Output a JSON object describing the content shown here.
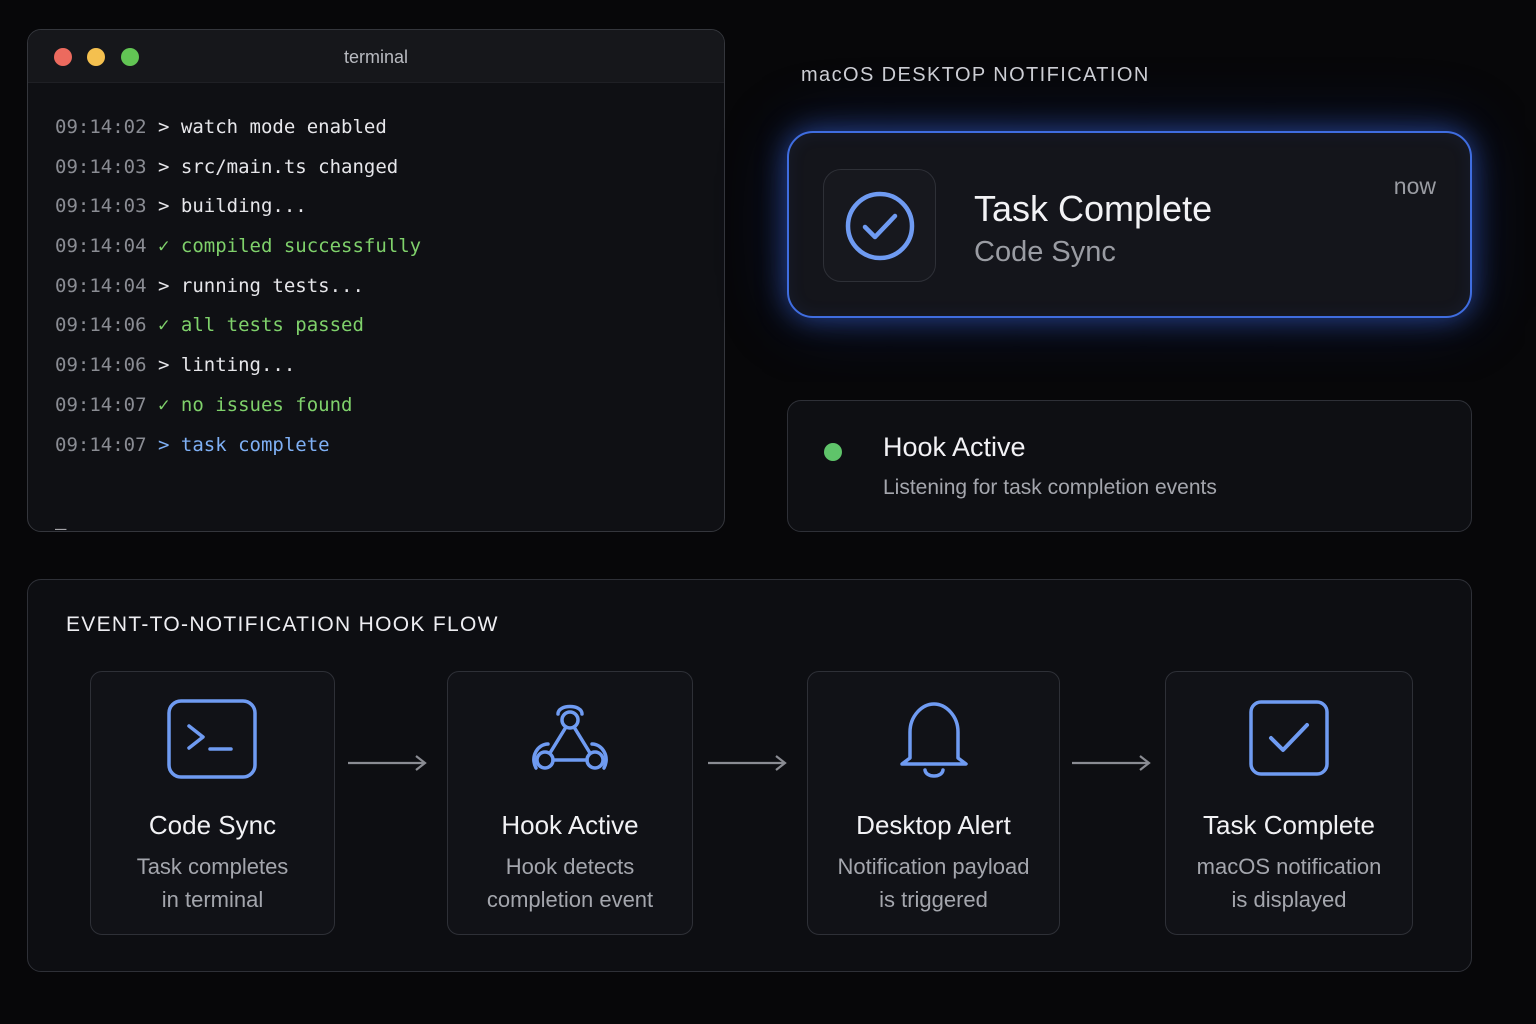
{
  "terminal": {
    "title": "terminal",
    "lines": [
      {
        "time": "09:14:02",
        "prefix": ">",
        "text": "watch mode enabled",
        "kind": "normal"
      },
      {
        "time": "09:14:03",
        "prefix": ">",
        "text": "src/main.ts changed",
        "kind": "normal"
      },
      {
        "time": "09:14:03",
        "prefix": ">",
        "text": "building...",
        "kind": "normal"
      },
      {
        "time": "09:14:04",
        "prefix": "✓",
        "text": "compiled successfully",
        "kind": "success"
      },
      {
        "time": "09:14:04",
        "prefix": ">",
        "text": "running tests...",
        "kind": "normal"
      },
      {
        "time": "09:14:06",
        "prefix": "✓",
        "text": "all tests passed",
        "kind": "success"
      },
      {
        "time": "09:14:06",
        "prefix": ">",
        "text": "linting...",
        "kind": "normal"
      },
      {
        "time": "09:14:07",
        "prefix": "✓",
        "text": "no issues found",
        "kind": "success"
      },
      {
        "time": "09:14:07",
        "prefix": ">",
        "text": "task complete",
        "kind": "info"
      }
    ],
    "cursor": "_"
  },
  "notification_section": {
    "heading": "macOS DESKTOP NOTIFICATION",
    "notification": {
      "icon": "check-circle-icon",
      "title": "Task Complete",
      "subtitle": "Code Sync",
      "time": "now"
    }
  },
  "hook_status": {
    "title": "Hook Active",
    "description": "Listening for task completion events",
    "status_color": "#5fc46a"
  },
  "flow": {
    "heading": "EVENT-TO-NOTIFICATION HOOK FLOW",
    "steps": [
      {
        "icon": "terminal-icon",
        "title": "Code Sync",
        "line1": "Task completes",
        "line2": "in terminal"
      },
      {
        "icon": "webhook-icon",
        "title": "Hook Active",
        "line1": "Hook detects",
        "line2": "completion event"
      },
      {
        "icon": "bell-icon",
        "title": "Desktop Alert",
        "line1": "Notification payload",
        "line2": "is triggered"
      },
      {
        "icon": "checkbox-icon",
        "title": "Task Complete",
        "line1": "macOS notification",
        "line2": "is displayed"
      }
    ]
  },
  "colors": {
    "accent": "#6f9bf2",
    "success": "#7fd16b",
    "background": "#070709"
  }
}
